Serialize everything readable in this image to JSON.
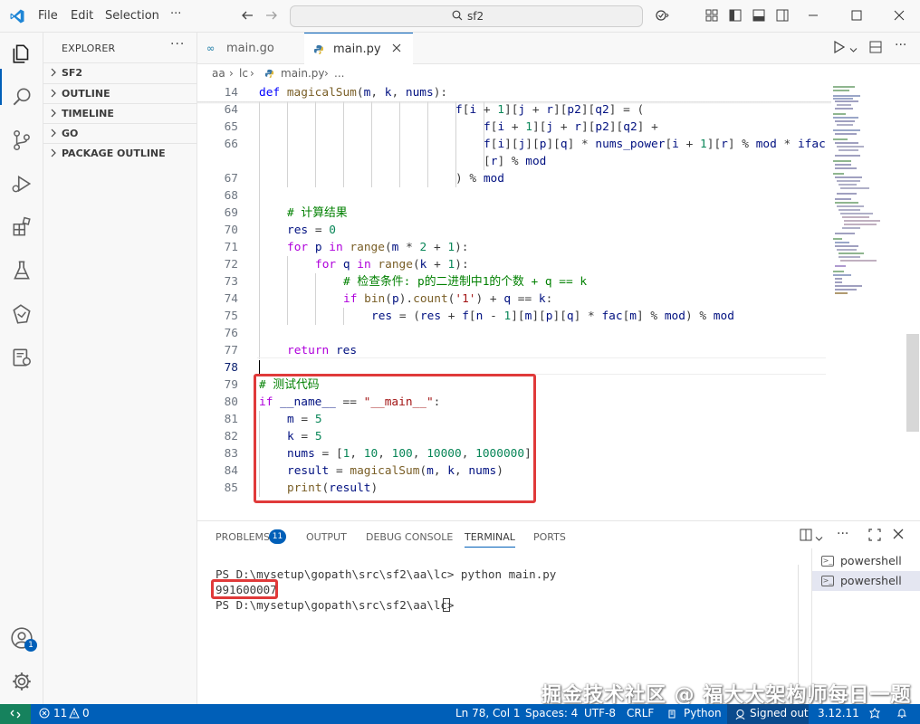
{
  "menu": {
    "file": "File",
    "edit": "Edit",
    "selection": "Selection",
    "more": "···"
  },
  "search": {
    "text": "sf2"
  },
  "sidebar": {
    "title": "EXPLORER",
    "sections": [
      "SF2",
      "OUTLINE",
      "TIMELINE",
      "GO",
      "PACKAGE OUTLINE"
    ]
  },
  "tabs": [
    {
      "label": "main.go",
      "icon": "go-file-icon"
    },
    {
      "label": "main.py",
      "icon": "python-file-icon"
    }
  ],
  "breadcrumb": [
    "aa",
    "lc",
    "main.py",
    "..."
  ],
  "code": {
    "sticky": {
      "num": "14",
      "text": "def magicalSum(m, k, nums):"
    },
    "lines": [
      {
        "num": "64",
        "text": "f[i + 1][j + r][p2][q2] = ("
      },
      {
        "num": "65",
        "text": "f[i + 1][j + r][p2][q2] +"
      },
      {
        "num": "66",
        "text": "f[i][j][p][q] * nums_power[i + 1][r] % mod * ifac"
      },
      {
        "num": "",
        "text": "[r] % mod"
      },
      {
        "num": "67",
        "text": ") % mod"
      },
      {
        "num": "68",
        "text": ""
      },
      {
        "num": "69",
        "text": "# 计算结果"
      },
      {
        "num": "70",
        "text": "res = 0"
      },
      {
        "num": "71",
        "text": "for p in range(m * 2 + 1):"
      },
      {
        "num": "72",
        "text": "for q in range(k + 1):"
      },
      {
        "num": "73",
        "text": "# 检查条件: p的二进制中1的个数 + q == k"
      },
      {
        "num": "74",
        "text": "if bin(p).count('1') + q == k:"
      },
      {
        "num": "75",
        "text": "res = (res + f[n - 1][m][p][q] * fac[m] % mod) % mod"
      },
      {
        "num": "76",
        "text": ""
      },
      {
        "num": "77",
        "text": "return res"
      },
      {
        "num": "78",
        "text": ""
      },
      {
        "num": "79",
        "text": "# 测试代码"
      },
      {
        "num": "80",
        "text": "if __name__ == \"__main__\":"
      },
      {
        "num": "81",
        "text": "m = 5"
      },
      {
        "num": "82",
        "text": "k = 5"
      },
      {
        "num": "83",
        "text": "nums = [1, 10, 100, 10000, 1000000]"
      },
      {
        "num": "84",
        "text": "result = magicalSum(m, k, nums)"
      },
      {
        "num": "85",
        "text": "print(result)"
      }
    ]
  },
  "panel": {
    "tabs": [
      "PROBLEMS",
      "OUTPUT",
      "DEBUG CONSOLE",
      "TERMINAL",
      "PORTS"
    ],
    "problems_count": "11",
    "terminal": {
      "line1": "PS D:\\mysetup\\gopath\\src\\sf2\\aa\\lc> python main.py",
      "output": "991600007",
      "line3": "PS D:\\mysetup\\gopath\\src\\sf2\\aa\\lc> "
    },
    "terminal_list": [
      "powershell",
      "powershell"
    ]
  },
  "watermark": "掘金技术社区 @ 福大大架构师每日一题",
  "account_badge": "1",
  "status": {
    "errors": "11",
    "warnings": "0",
    "position": "Ln 78, Col 1",
    "spaces": "Spaces: 4",
    "encoding": "UTF-8",
    "eol": "CRLF",
    "language": "Python",
    "signed": "Signed out",
    "version": "3.12.11"
  },
  "colors": {
    "accent": "#005fb8",
    "highlight_box": "#e03a3a",
    "remote": "#16825d"
  }
}
